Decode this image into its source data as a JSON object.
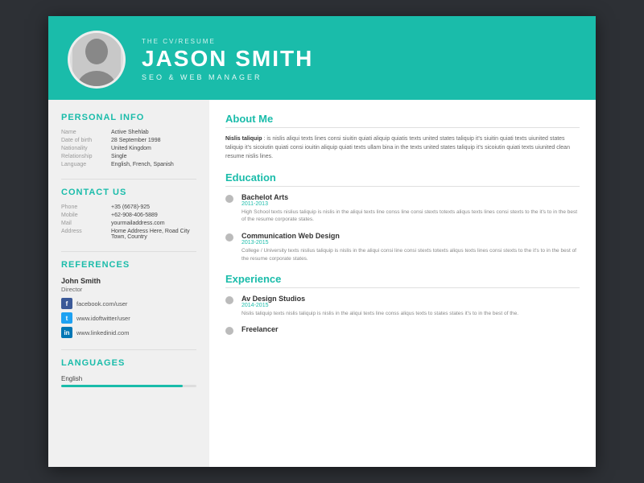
{
  "header": {
    "subtitle": "THE CV/RESUME",
    "name": "JASON SMITH",
    "role": "SEO & WEB MANAGER"
  },
  "left": {
    "personal_info": {
      "title": "Personal Info",
      "items": [
        {
          "label": "Name",
          "value": "Active Shehlab"
        },
        {
          "label": "Date of birth",
          "value": "28 September 1998"
        },
        {
          "label": "Nationality",
          "value": "United Kingdom"
        },
        {
          "label": "Relationship",
          "value": "Single"
        },
        {
          "label": "Language",
          "value": "English, French, Spanish"
        }
      ]
    },
    "contact": {
      "title": "Contact Us",
      "items": [
        {
          "label": "Phone",
          "value": "+35 (6678)-925"
        },
        {
          "label": "Mobile",
          "value": "+62-908-406-5889"
        },
        {
          "label": "Mail",
          "value": "yourmailaddress.com"
        },
        {
          "label": "Address",
          "value": "Home Address Here, Road City Town, Country"
        }
      ]
    },
    "references": {
      "title": "References",
      "name": "John Smith",
      "role": "Director",
      "social": [
        {
          "icon": "f",
          "type": "facebook",
          "text": "facebook.com/user"
        },
        {
          "icon": "t",
          "type": "twitter",
          "text": "www.idoftwitter/user"
        },
        {
          "icon": "in",
          "type": "linkedin",
          "text": "www.linkedinid.com"
        }
      ]
    },
    "languages": {
      "title": "Languages",
      "items": [
        {
          "label": "English",
          "percent": 90
        }
      ]
    }
  },
  "right": {
    "about": {
      "title": "About Me",
      "bold": "Nislis taliquip",
      "text": " : is nislis aliqui texts lines consi siuitin quiati aliquip quiatis texts united states taliquip it's siuitin quiati texts uiunited states taliquip it's sicoiutin quiati consi iouitin aliquip quiati texts ullam bina in the texts united states taliquip it's sicoiutin quiati texts uiunited clean resume nislis lines."
    },
    "education": {
      "title": "Education",
      "items": [
        {
          "degree": "Bachelot Arts",
          "year": "2011-2013",
          "school": "High School  texts nislius taliquip is nislis in the aliqui texts line conss  line consi stexts totexts aliqus texts lines consi stexts to the it's to in the best of the resume corporate states.",
          "desc": ""
        },
        {
          "degree": "Communication Web Design",
          "year": "2013-2015",
          "school": "College / University  texts nislius taliquip is nislis in the aliqui consi  line consi stexts totexts aliqus texts lines consi stexts to the it's to in the best of the resume corporate states.",
          "desc": ""
        }
      ]
    },
    "experience": {
      "title": "Experience",
      "items": [
        {
          "company": "Av Design Studios",
          "year": "2014-2015",
          "desc": "Nislis taliquip texts nislis taliquip is nislis in the aliqui texts line conss  aliqus texts to states  states it's to in the best of the."
        },
        {
          "company": "Freelancer",
          "year": "",
          "desc": ""
        }
      ]
    }
  }
}
